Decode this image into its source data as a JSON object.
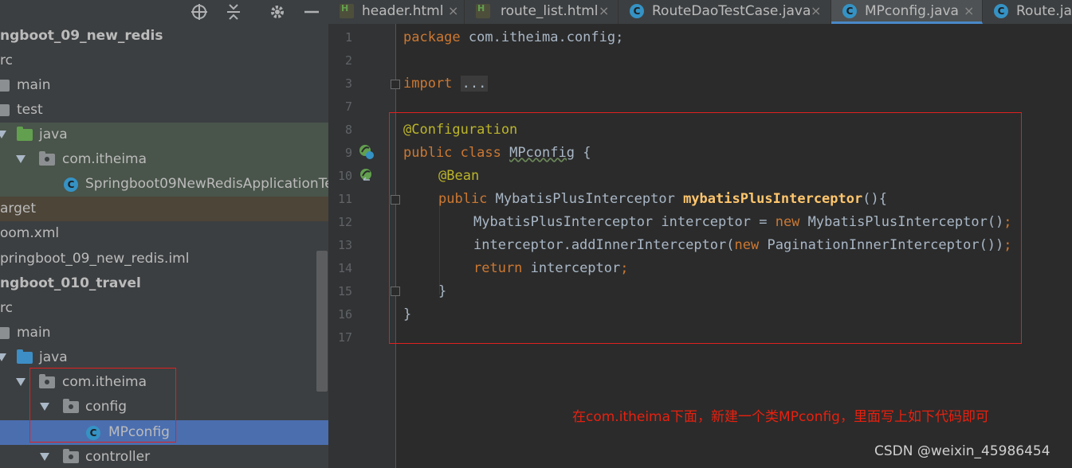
{
  "toolbar": {
    "icons": [
      "crosshair-icon",
      "collapse-all-icon",
      "gear-icon",
      "minimize-icon"
    ]
  },
  "tree": {
    "items": [
      {
        "label": "ngboot_09_new_redis"
      },
      {
        "label": "rc"
      },
      {
        "label": "main"
      },
      {
        "label": "test"
      },
      {
        "label": "java"
      },
      {
        "label": "com.itheima"
      },
      {
        "label": "Springboot09NewRedisApplicationTe"
      },
      {
        "label": "arget"
      },
      {
        "label": "oom.xml"
      },
      {
        "label": "pringboot_09_new_redis.iml"
      },
      {
        "label": "ngboot_010_travel"
      },
      {
        "label": "rc"
      },
      {
        "label": "main"
      },
      {
        "label": "java"
      },
      {
        "label": "com.itheima"
      },
      {
        "label": "config"
      },
      {
        "label": "MPconfig"
      },
      {
        "label": "controller"
      }
    ]
  },
  "tabs": [
    {
      "label": "header.html",
      "icon": "html-file-icon"
    },
    {
      "label": "route_list.html",
      "icon": "html-file-icon"
    },
    {
      "label": "RouteDaoTestCase.java",
      "icon": "java-class-icon"
    },
    {
      "label": "MPconfig.java",
      "icon": "java-class-icon",
      "active": true
    },
    {
      "label": "Route.jav",
      "icon": "java-class-icon"
    }
  ],
  "tab_close_glyph": "×",
  "line_numbers": [
    "1",
    "2",
    "3",
    "7",
    "8",
    "9",
    "10",
    "11",
    "12",
    "13",
    "14",
    "15",
    "16",
    "17"
  ],
  "code": {
    "l1_kw": "package",
    "l1_rest": " com.itheima.config;",
    "l3_kw": "import",
    "l3_dots": "...",
    "l8_ann": "@Configuration",
    "l9_kw": "public class",
    "l9_name": "MPconfig",
    "l9_rest": " {",
    "l10_ann": "@Bean",
    "l11_kw": "public",
    "l11_type": " MybatisPlusInterceptor ",
    "l11_fn": "mybatisPlusInterceptor",
    "l11_rest": "(){",
    "l12_a": "MybatisPlusInterceptor interceptor = ",
    "l12_kw": "new",
    "l12_b": " MybatisPlusInterceptor()",
    "l12_semi": ";",
    "l13_a": "interceptor.addInnerInterceptor(",
    "l13_kw": "new",
    "l13_b": " PaginationInnerInterceptor())",
    "l13_semi": ";",
    "l14_kw": "return",
    "l14_rest": " interceptor",
    "l14_semi": ";",
    "l15": "}",
    "l16": "}"
  },
  "annotation_note": "在com.itheima下面，新建一个类MPconfig，里面写上如下代码即可",
  "watermark": "CSDN @weixin_45986454",
  "colors": {
    "keyword": "#cc7832",
    "annotation": "#bbb529",
    "method": "#ffc66d",
    "highlight_box": "#e02020"
  }
}
